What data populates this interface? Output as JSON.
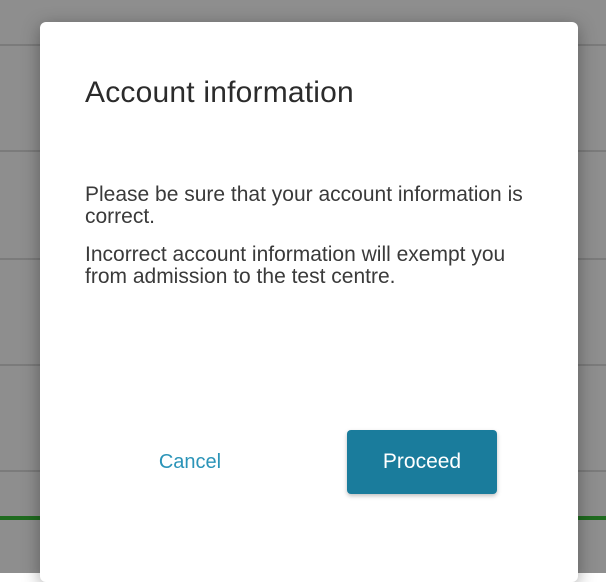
{
  "dialog": {
    "title": "Account information",
    "paragraphs": [
      "Please be sure that your account information is correct.",
      "Incorrect account information will exempt you from admission to the test centre."
    ],
    "cancel_label": "Cancel",
    "proceed_label": "Proceed"
  },
  "colors": {
    "overlay": "#8e8e8e",
    "accent": "#1a7c9c",
    "link": "#2b94b8",
    "background_highlight": "#1f6b1f"
  }
}
